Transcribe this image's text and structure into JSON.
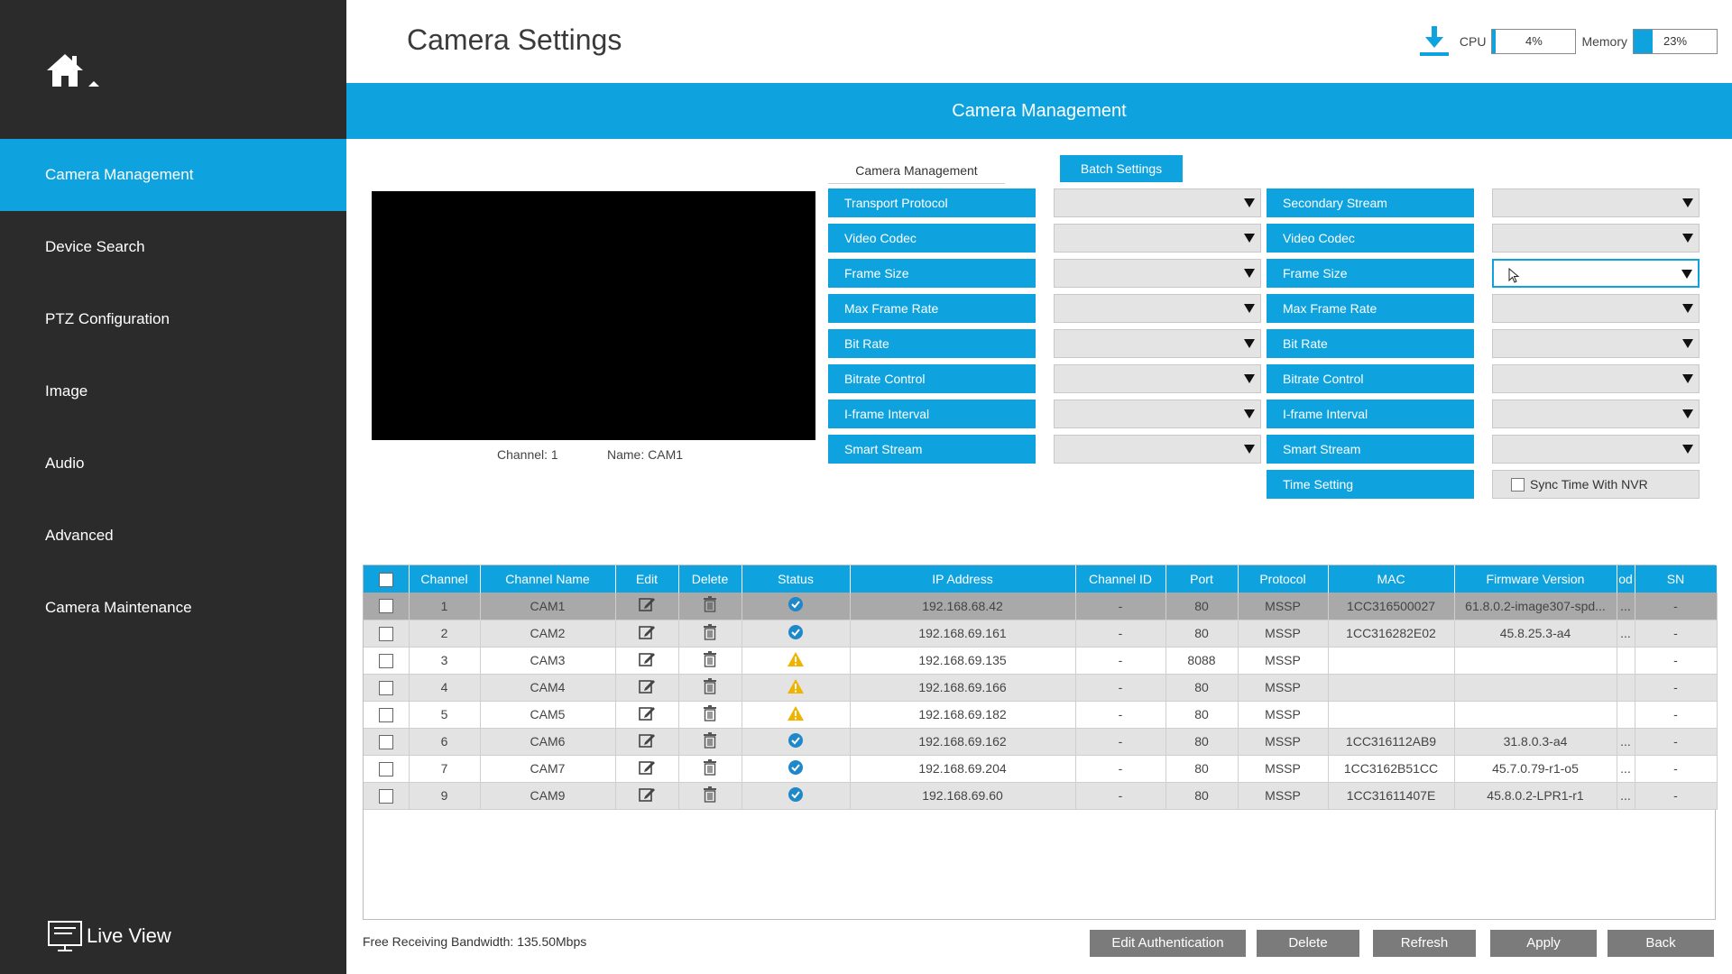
{
  "sidebar": {
    "items": [
      {
        "label": "Camera Management",
        "active": true
      },
      {
        "label": "Device Search",
        "active": false
      },
      {
        "label": "PTZ Configuration",
        "active": false
      },
      {
        "label": "Image",
        "active": false
      },
      {
        "label": "Audio",
        "active": false
      },
      {
        "label": "Advanced",
        "active": false
      },
      {
        "label": "Camera Maintenance",
        "active": false
      }
    ],
    "live_view_label": "Live View",
    "home_icon": "home-icon"
  },
  "header": {
    "title": "Camera Settings",
    "cpu_label": "CPU",
    "cpu_value": "4%",
    "cpu_percent": 4,
    "memory_label": "Memory",
    "memory_value": "23%",
    "memory_percent": 23
  },
  "banner": {
    "title": "Camera Management"
  },
  "preview": {
    "channel_text": "Channel: 1",
    "name_text": "Name: CAM1"
  },
  "settings": {
    "tab_camera_management": "Camera Management",
    "tab_batch_settings": "Batch Settings",
    "left_labels": [
      "Transport Protocol",
      "Video Codec",
      "Frame Size",
      "Max Frame Rate",
      "Bit Rate",
      "Bitrate Control",
      "I-frame Interval",
      "Smart Stream"
    ],
    "right_labels": [
      "Secondary Stream",
      "Video Codec",
      "Frame Size",
      "Max Frame Rate",
      "Bit Rate",
      "Bitrate Control",
      "I-frame Interval",
      "Smart Stream",
      "Time Setting"
    ],
    "sync_time_label": "Sync Time With NVR"
  },
  "table": {
    "columns": [
      "Channel",
      "Channel Name",
      "Edit",
      "Delete",
      "Status",
      "IP Address",
      "Channel ID",
      "Port",
      "Protocol",
      "MAC",
      "Firmware Version",
      "od",
      "SN"
    ],
    "rows": [
      {
        "channel": "1",
        "name": "CAM1",
        "status": "ok",
        "ip": "192.168.68.42",
        "chid": "-",
        "port": "80",
        "protocol": "MSSP",
        "mac": "1CC316500027",
        "firmware": "61.8.0.2-image307-spd...",
        "od": "...",
        "sn": "-"
      },
      {
        "channel": "2",
        "name": "CAM2",
        "status": "ok",
        "ip": "192.168.69.161",
        "chid": "-",
        "port": "80",
        "protocol": "MSSP",
        "mac": "1CC316282E02",
        "firmware": "45.8.25.3-a4",
        "od": "...",
        "sn": "-"
      },
      {
        "channel": "3",
        "name": "CAM3",
        "status": "warning",
        "ip": "192.168.69.135",
        "chid": "-",
        "port": "8088",
        "protocol": "MSSP",
        "mac": "",
        "firmware": "",
        "od": "",
        "sn": "-"
      },
      {
        "channel": "4",
        "name": "CAM4",
        "status": "warning",
        "ip": "192.168.69.166",
        "chid": "-",
        "port": "80",
        "protocol": "MSSP",
        "mac": "",
        "firmware": "",
        "od": "",
        "sn": "-"
      },
      {
        "channel": "5",
        "name": "CAM5",
        "status": "warning",
        "ip": "192.168.69.182",
        "chid": "-",
        "port": "80",
        "protocol": "MSSP",
        "mac": "",
        "firmware": "",
        "od": "",
        "sn": "-"
      },
      {
        "channel": "6",
        "name": "CAM6",
        "status": "ok",
        "ip": "192.168.69.162",
        "chid": "-",
        "port": "80",
        "protocol": "MSSP",
        "mac": "1CC316112AB9",
        "firmware": "31.8.0.3-a4",
        "od": "...",
        "sn": "-"
      },
      {
        "channel": "7",
        "name": "CAM7",
        "status": "ok",
        "ip": "192.168.69.204",
        "chid": "-",
        "port": "80",
        "protocol": "MSSP",
        "mac": "1CC3162B51CC",
        "firmware": "45.7.0.79-r1-o5",
        "od": "...",
        "sn": "-"
      },
      {
        "channel": "9",
        "name": "CAM9",
        "status": "ok",
        "ip": "192.168.69.60",
        "chid": "-",
        "port": "80",
        "protocol": "MSSP",
        "mac": "1CC31611407E",
        "firmware": "45.8.0.2-LPR1-r1",
        "od": "...",
        "sn": "-"
      }
    ]
  },
  "footer": {
    "bandwidth": "Free Receiving Bandwidth: 135.50Mbps",
    "buttons": [
      "Edit Authentication",
      "Delete",
      "Refresh",
      "Apply",
      "Back"
    ]
  },
  "colors": {
    "accent": "#0ea3de",
    "sidebar": "#2b2b2b",
    "ok": "#1e88c8",
    "warning": "#f0b400",
    "button": "#7b7b7b"
  }
}
